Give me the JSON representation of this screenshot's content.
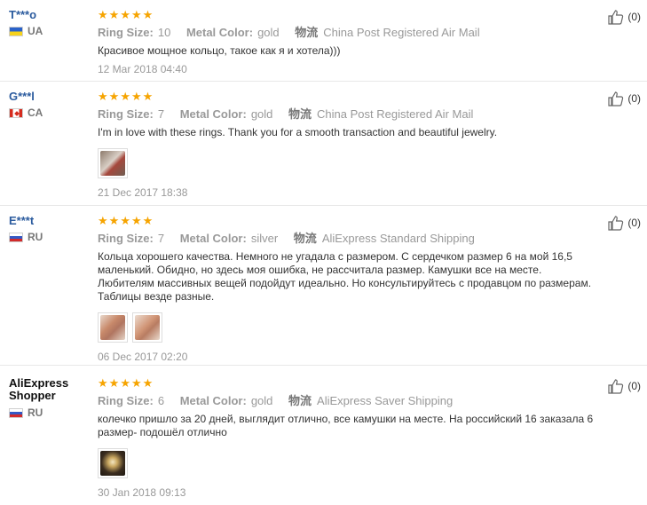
{
  "reviews": [
    {
      "user": "T***o",
      "country": "UA",
      "flag": "ua",
      "rating": 5,
      "ring_size_label": "Ring Size:",
      "ring_size": "10",
      "metal_label": "Metal Color:",
      "metal": "gold",
      "logistics_label": "物流",
      "shipping": "China Post Registered Air Mail",
      "text": "Красивое мощное кольцо, такое как я и хотела)))",
      "photos": [],
      "date": "12 Mar 2018 04:40",
      "helpful_count": "(0)"
    },
    {
      "user": "G***l",
      "country": "CA",
      "flag": "ca",
      "rating": 5,
      "ring_size_label": "Ring Size:",
      "ring_size": "7",
      "metal_label": "Metal Color:",
      "metal": "gold",
      "logistics_label": "物流",
      "shipping": "China Post Registered Air Mail",
      "text": "I'm in love with these rings. Thank you for a smooth transaction and beautiful jewelry.",
      "photos": [
        "#b9a394"
      ],
      "date": "21 Dec 2017 18:38",
      "helpful_count": "(0)"
    },
    {
      "user": "E***t",
      "country": "RU",
      "flag": "ru",
      "rating": 5,
      "ring_size_label": "Ring Size:",
      "ring_size": "7",
      "metal_label": "Metal Color:",
      "metal": "silver",
      "logistics_label": "物流",
      "shipping": "AliExpress Standard Shipping",
      "text": "Кольца хорошего качества. Немного не угадала с размером. С сердечком размер 6 на мой 16,5 маленький. Обидно, но здесь моя ошибка, не рассчитала размер. Камушки все на месте. Любителям массивных вещей подойдут идеально. Но консультируйтесь с продавцом по размерам. Таблицы везде разные.",
      "photos": [
        "#c99a82",
        "#d4a488"
      ],
      "date": "06 Dec 2017 02:20",
      "helpful_count": "(0)"
    },
    {
      "user": "AliExpress Shopper",
      "country": "RU",
      "flag": "ru",
      "rating": 5,
      "ring_size_label": "Ring Size:",
      "ring_size": "6",
      "metal_label": "Metal Color:",
      "metal": "gold",
      "logistics_label": "物流",
      "shipping": "AliExpress Saver Shipping",
      "text": "колечко пришло за 20 дней, выглядит отлично, все камушки на месте. На российский 16 заказала 6 размер- подошёл отлично",
      "photos": [
        "#5a4632"
      ],
      "date": "30 Jan 2018 09:13",
      "helpful_count": "(0)"
    }
  ]
}
